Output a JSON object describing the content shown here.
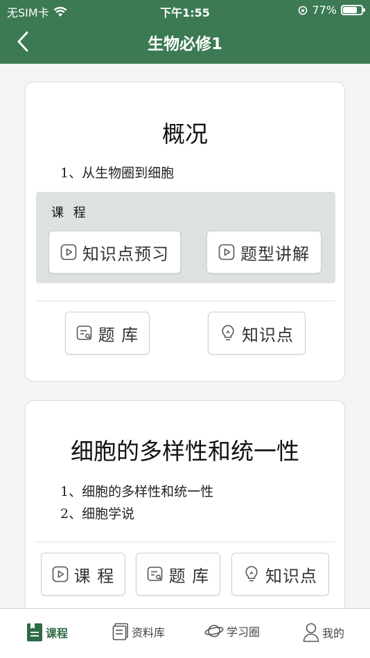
{
  "status_bar": {
    "carrier": "无SIM卡",
    "time": "下午1:55",
    "battery_pct": "77%",
    "battery_level": 0.77
  },
  "nav": {
    "title": "生物必修1"
  },
  "cards": [
    {
      "title": "概况",
      "lessons": [
        "1、从生物圈到细胞"
      ],
      "course_section_label": "课 程",
      "course_buttons": [
        "知识点预习",
        "题型讲解"
      ],
      "bottom_buttons": [
        "题 库",
        "知识点"
      ]
    },
    {
      "title": "细胞的多样性和统一性",
      "lessons": [
        "1、细胞的多样性和统一性",
        "2、细胞学说"
      ],
      "bottom_buttons": [
        "课 程",
        "题 库",
        "知识点"
      ]
    }
  ],
  "tabbar": {
    "items": [
      {
        "label": "课程",
        "icon": "book-icon",
        "active": true
      },
      {
        "label": "资料库",
        "icon": "archive-icon",
        "active": false
      },
      {
        "label": "学习圈",
        "icon": "planet-icon",
        "active": false
      },
      {
        "label": "我的",
        "icon": "person-icon",
        "active": false
      }
    ]
  },
  "colors": {
    "accent": "#3b7a53",
    "active_tab": "#2e6a46",
    "section_bg": "#dde2df"
  }
}
